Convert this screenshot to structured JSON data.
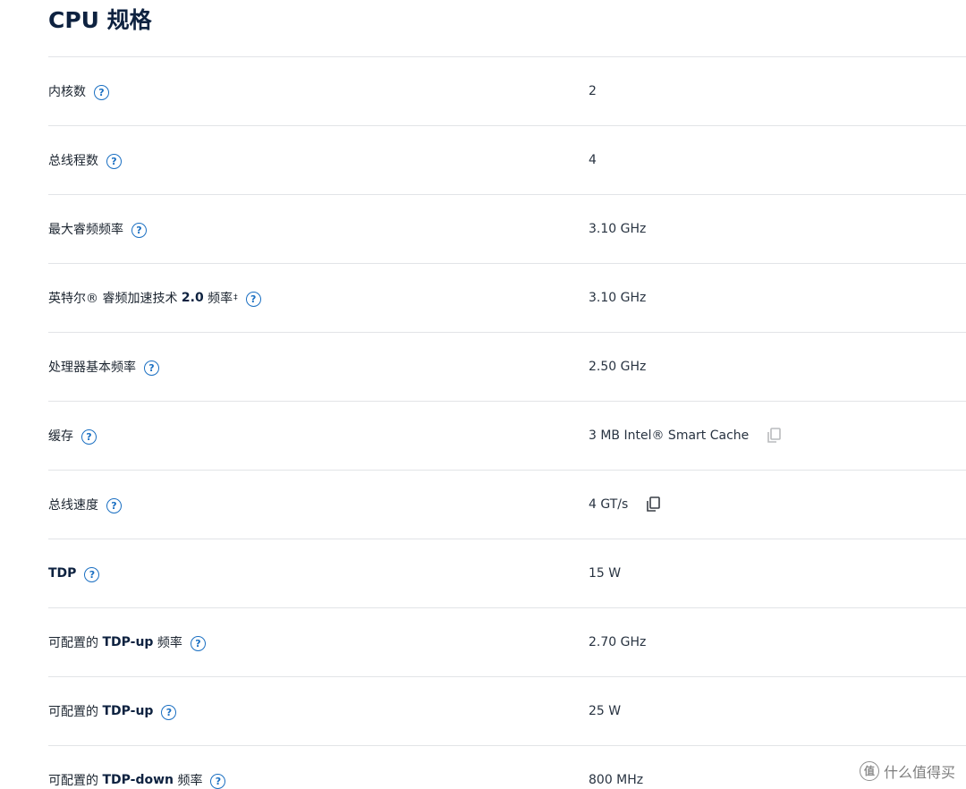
{
  "page": {
    "title": "CPU 规格"
  },
  "help_icon_glyph": "?",
  "specs": [
    {
      "label_parts": [
        {
          "text": "内核数"
        }
      ],
      "value": "2"
    },
    {
      "label_parts": [
        {
          "text": "总线程数"
        }
      ],
      "value": "4"
    },
    {
      "label_parts": [
        {
          "text": "最大睿频频率"
        }
      ],
      "value": "3.10 GHz"
    },
    {
      "label_parts": [
        {
          "text": "英特尔® 睿频加速技术 "
        },
        {
          "text": "2.0",
          "bold": true
        },
        {
          "text": " 频率"
        },
        {
          "text": "‡",
          "sup": true
        }
      ],
      "value": "3.10 GHz"
    },
    {
      "label_parts": [
        {
          "text": "处理器基本频率"
        }
      ],
      "value": "2.50 GHz"
    },
    {
      "label_parts": [
        {
          "text": "缓存"
        }
      ],
      "value": "3 MB Intel® Smart Cache",
      "copy_icon": "copy-icon",
      "copy_faded": true
    },
    {
      "label_parts": [
        {
          "text": "总线速度"
        }
      ],
      "value": "4 GT/s",
      "copy_icon": "copy-icon"
    },
    {
      "label_parts": [
        {
          "text": "TDP",
          "bold": true
        }
      ],
      "value": "15 W"
    },
    {
      "label_parts": [
        {
          "text": "可配置的 "
        },
        {
          "text": "TDP-up",
          "bold": true
        },
        {
          "text": " 频率"
        }
      ],
      "value": "2.70 GHz"
    },
    {
      "label_parts": [
        {
          "text": "可配置的 "
        },
        {
          "text": "TDP-up",
          "bold": true
        }
      ],
      "value": "25 W"
    },
    {
      "label_parts": [
        {
          "text": "可配置的 "
        },
        {
          "text": "TDP-down",
          "bold": true
        },
        {
          "text": " 频率"
        }
      ],
      "value": "800 MHz"
    }
  ],
  "watermark": {
    "logo_glyph": "值",
    "text": "什么值得买"
  },
  "colors": {
    "title": "#0e2240",
    "help_icon": "#1a6fc2",
    "divider": "#e2e4e7"
  }
}
